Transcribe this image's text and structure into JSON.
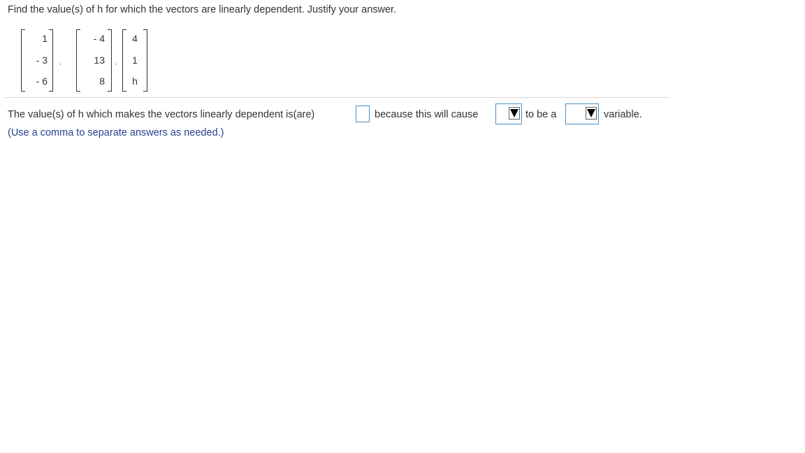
{
  "question": "Find the value(s) of h for which the vectors are linearly dependent. Justify your answer.",
  "vectors": [
    [
      "1",
      "- 3",
      "- 6"
    ],
    [
      "- 4",
      "13",
      "8"
    ],
    [
      "4",
      "1",
      "h"
    ]
  ],
  "separator": ",",
  "answer": {
    "prefix": "The value(s) of h which makes the vectors linearly dependent is(are)",
    "input_value": "",
    "middle": "because this will cause",
    "dropdown1_value": "",
    "between": "to be a",
    "dropdown2_value": "",
    "suffix": "variable."
  },
  "hint": "(Use a comma to separate answers as needed.)",
  "colors": {
    "text": "#333333",
    "hint": "#2a3f8f",
    "input_border": "#4a90c8",
    "divider": "#d5d5d5"
  },
  "icons": {
    "dropdown_arrow": "triangle-down-icon"
  }
}
